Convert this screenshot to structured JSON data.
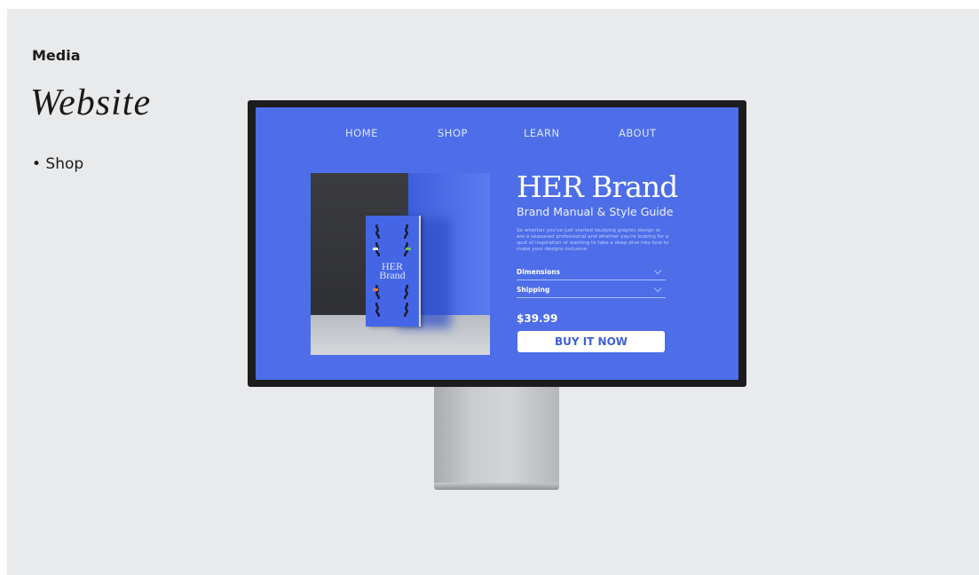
{
  "slide": {
    "label": "Media",
    "title": "Website",
    "bullet": "• Shop"
  },
  "screen": {
    "nav": [
      "HOME",
      "SHOP",
      "LEARN",
      "ABOUT"
    ],
    "hero": {
      "title": "HER Brand",
      "subtitle": "Brand Manual & Style Guide",
      "body": "So whether you've just started studying graphic design or are a seasoned professional and whether you're looking for a spot of inspiration or wanting to take a deep dive into how to make your designs inclusive"
    },
    "book": {
      "title_line1": "HER",
      "title_line2": "Brand"
    },
    "accordion": [
      {
        "label": "Dimensions"
      },
      {
        "label": "Shipping"
      }
    ],
    "price": "$39.99",
    "buy_label": "BUY IT NOW"
  },
  "colors": {
    "background": "#e9eaec",
    "screen_blue": "#4d6ee8",
    "bezel": "#1c1c1e",
    "button": "#ffffff",
    "button_text": "#3e5fd6"
  },
  "icons": [
    "chevron-down-icon"
  ]
}
